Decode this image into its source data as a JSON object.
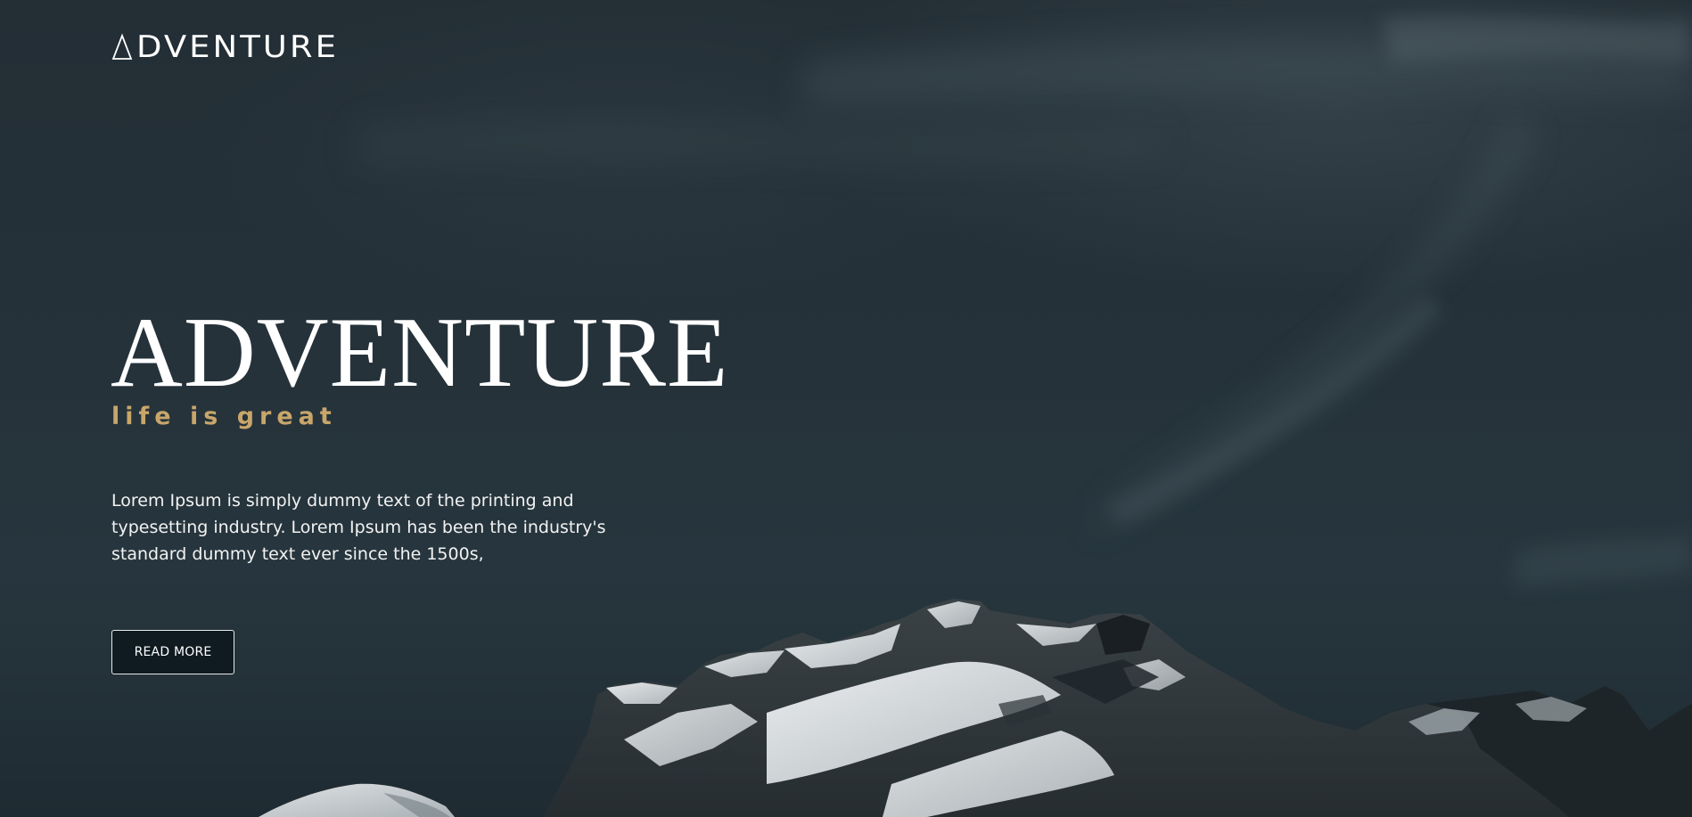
{
  "logo": {
    "text": "DVENTURE",
    "icon": "triangle-a-icon"
  },
  "hero": {
    "headline": "ADVENTURE",
    "tagline": "life is great",
    "body_line_1": "Lorem Ipsum is simply dummy text of the printing and",
    "body_line_2": "typesetting industry. Lorem Ipsum has been the industry's",
    "body_line_3": "standard dummy text ever since the 1500s,",
    "button_label": "READ MORE"
  },
  "colors": {
    "sky": "#25323a",
    "accent": "#c8a66a",
    "text": "#ffffff",
    "button_bg": "#0f1a21"
  }
}
